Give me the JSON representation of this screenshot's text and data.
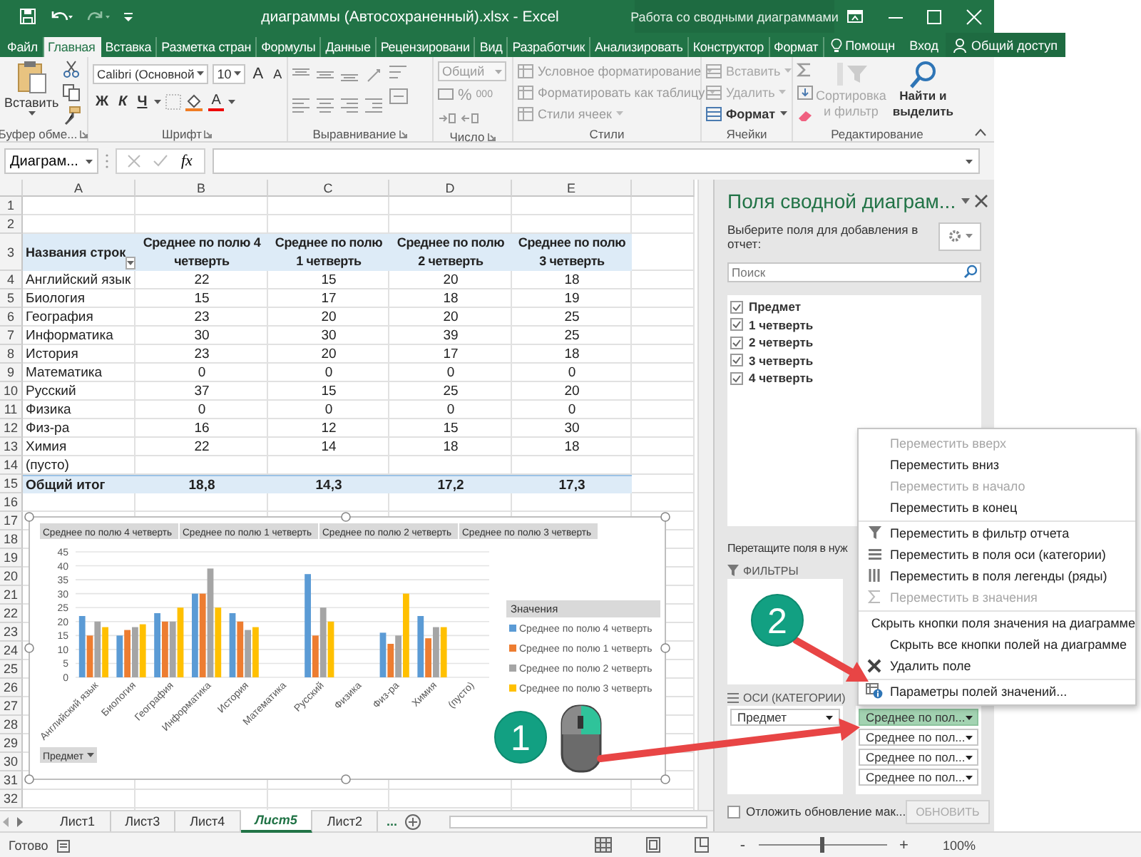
{
  "window": {
    "title": "диаграммы (Автосохраненный).xlsx - Excel",
    "context_title": "Работа со сводными диаграммами"
  },
  "ribbon_tabs": [
    {
      "label": "Файл",
      "selected": false
    },
    {
      "label": "Главная",
      "selected": true
    },
    {
      "label": "Вставка",
      "selected": false
    },
    {
      "label": "Разметка стран",
      "selected": false
    },
    {
      "label": "Формулы",
      "selected": false
    },
    {
      "label": "Данные",
      "selected": false
    },
    {
      "label": "Рецензировани",
      "selected": false
    },
    {
      "label": "Вид",
      "selected": false
    },
    {
      "label": "Разработчик",
      "selected": false
    },
    {
      "label": "Анализировать",
      "selected": false
    },
    {
      "label": "Конструктор",
      "selected": false
    },
    {
      "label": "Формат",
      "selected": false
    }
  ],
  "tell_me": "Помощн",
  "sign_in": "Вход",
  "share": "Общий доступ",
  "ribbon": {
    "clipboard": {
      "paste": "Вставить",
      "label": "Буфер обме..."
    },
    "font": {
      "name": "Calibri (Основной",
      "size": "10",
      "grow": "A",
      "shrink": "A",
      "bold": "Ж",
      "italic": "К",
      "underline": "Ч",
      "color_letter": "A",
      "label": "Шрифт"
    },
    "alignment": {
      "label": "Выравнивание"
    },
    "number": {
      "format": "Общий",
      "percent": "%",
      "thousands": "000",
      "label": "Число"
    },
    "styles": {
      "items": [
        "Условное форматирование",
        "Форматировать как таблицу",
        "Стили ячеек"
      ],
      "label": "Стили"
    },
    "cells": {
      "items": [
        {
          "label": "Вставить",
          "disabled": true
        },
        {
          "label": "Удалить",
          "disabled": true
        },
        {
          "label": "Формат",
          "disabled": false
        }
      ],
      "label": "Ячейки"
    },
    "editing": {
      "sort": {
        "label": "Сортировка и фильтр",
        "disabled": true
      },
      "find": "Найти и выделить",
      "label": "Редактирование"
    }
  },
  "formula_bar": {
    "name_box": "Диаграм...",
    "function_label": "fx"
  },
  "columns": [
    "A",
    "B",
    "C",
    "D",
    "E"
  ],
  "row_numbers": [
    "1",
    "2",
    "3",
    "4",
    "5",
    "6",
    "7",
    "8",
    "9",
    "10",
    "11",
    "12",
    "13",
    "14",
    "15",
    "16",
    "17",
    "18",
    "19",
    "20",
    "21",
    "22",
    "23",
    "24",
    "25",
    "26",
    "27",
    "28",
    "29",
    "30",
    "31",
    "32"
  ],
  "pivot_table": {
    "row_header": "Названия строк",
    "value_headers": [
      "Среднее по полю 4 четверть",
      "Среднее по полю 1 четверть",
      "Среднее по полю 2 четверть",
      "Среднее по полю 3 четверть"
    ],
    "rows": [
      {
        "label": "Английский язык",
        "values": [
          "22",
          "15",
          "20",
          "18"
        ]
      },
      {
        "label": "Биология",
        "values": [
          "15",
          "17",
          "18",
          "19"
        ]
      },
      {
        "label": "География",
        "values": [
          "23",
          "20",
          "20",
          "25"
        ]
      },
      {
        "label": "Информатика",
        "values": [
          "30",
          "30",
          "39",
          "25"
        ]
      },
      {
        "label": "История",
        "values": [
          "23",
          "20",
          "17",
          "18"
        ]
      },
      {
        "label": "Математика",
        "values": [
          "0",
          "0",
          "0",
          "0"
        ]
      },
      {
        "label": "Русский",
        "values": [
          "37",
          "15",
          "25",
          "20"
        ]
      },
      {
        "label": "Физика",
        "values": [
          "0",
          "0",
          "0",
          "0"
        ]
      },
      {
        "label": "Физ-ра",
        "values": [
          "16",
          "12",
          "15",
          "30"
        ]
      },
      {
        "label": "Химия",
        "values": [
          "22",
          "14",
          "18",
          "18"
        ]
      },
      {
        "label": "(пусто)",
        "values": []
      }
    ],
    "total": {
      "label": "Общий итог",
      "values": [
        "18,8",
        "14,3",
        "17,2",
        "17,3"
      ]
    }
  },
  "chart": {
    "field_buttons": [
      "Среднее по полю 4 четверть",
      "Среднее по полю 1 четверть",
      "Среднее по полю 2 четверть",
      "Среднее по полю 3 четверть"
    ],
    "axis_field_button": "Предмет",
    "legend_title": "Значения",
    "chart_data": {
      "type": "bar",
      "categories": [
        "Английский язык",
        "Биология",
        "География",
        "Информатика",
        "История",
        "Математика",
        "Русский",
        "Физика",
        "Физ-ра",
        "Химия",
        "(пусто)"
      ],
      "series": [
        {
          "name": "Среднее по полю 4 четверть",
          "color": "#5b9bd5",
          "values": [
            22,
            15,
            23,
            30,
            23,
            0,
            37,
            0,
            16,
            22,
            null
          ]
        },
        {
          "name": "Среднее по полю 1 четверть",
          "color": "#ed7d31",
          "values": [
            15,
            17,
            20,
            30,
            20,
            0,
            15,
            0,
            12,
            14,
            null
          ]
        },
        {
          "name": "Среднее по полю 2 четверть",
          "color": "#a5a5a5",
          "values": [
            20,
            18,
            20,
            39,
            17,
            0,
            25,
            0,
            15,
            18,
            null
          ]
        },
        {
          "name": "Среднее по полю 3 четверть",
          "color": "#ffc000",
          "values": [
            18,
            19,
            25,
            25,
            18,
            0,
            20,
            0,
            30,
            18,
            null
          ]
        }
      ],
      "ylim": [
        0,
        45
      ],
      "yticks": [
        0,
        5,
        10,
        15,
        20,
        25,
        30,
        35,
        40,
        45
      ],
      "grid": true,
      "legend": "right"
    }
  },
  "sheet_tabs": [
    {
      "label": "Лист1",
      "selected": false
    },
    {
      "label": "Лист3",
      "selected": false
    },
    {
      "label": "Лист4",
      "selected": false
    },
    {
      "label": "Лист5",
      "selected": true
    },
    {
      "label": "Лист2",
      "selected": false
    }
  ],
  "more_sheets": "...",
  "pane": {
    "title": "Поля сводной диаграм...",
    "prompt": "Выберите поля для добавления в отчет:",
    "search_placeholder": "Поиск",
    "fields": [
      {
        "label": "Предмет",
        "checked": true
      },
      {
        "label": "1 четверть",
        "checked": true
      },
      {
        "label": "2 четверть",
        "checked": true
      },
      {
        "label": "3 четверть",
        "checked": true
      },
      {
        "label": "4 четверть",
        "checked": true
      }
    ],
    "areas_prompt": "Перетащите поля в нуж",
    "filters_label": "ФИЛЬТРЫ",
    "axis_label": "ОСИ (КАТЕГОРИИ)",
    "axis_items": [
      "Предмет"
    ],
    "values": [
      {
        "label": "Среднее по пол...",
        "selected": true
      },
      {
        "label": "Среднее по пол...",
        "selected": false
      },
      {
        "label": "Среднее по пол...",
        "selected": false
      },
      {
        "label": "Среднее по пол...",
        "selected": false
      }
    ],
    "defer": {
      "label": "Отложить обновление мак...",
      "checked": false
    },
    "update": {
      "label": "ОБНОВИТЬ",
      "disabled": true
    }
  },
  "context_menu": {
    "items": [
      {
        "label": "Переместить вверх",
        "kind": "plain",
        "disabled": true,
        "separator_before": false
      },
      {
        "label": "Переместить вниз",
        "kind": "plain",
        "disabled": false,
        "separator_before": false
      },
      {
        "label": "Переместить в начало",
        "kind": "plain",
        "disabled": true,
        "separator_before": false
      },
      {
        "label": "Переместить в конец",
        "kind": "plain",
        "disabled": false,
        "separator_before": false
      },
      {
        "label": "Переместить в фильтр отчета",
        "kind": "filter",
        "disabled": false,
        "separator_before": true
      },
      {
        "label": "Переместить в поля оси (категории)",
        "kind": "axis",
        "disabled": false,
        "separator_before": false
      },
      {
        "label": "Переместить в поля легенды (ряды)",
        "kind": "legend",
        "disabled": false,
        "separator_before": false
      },
      {
        "label": "Переместить в значения",
        "kind": "sum",
        "disabled": true,
        "separator_before": false
      },
      {
        "label": "Скрыть кнопки поля значения на диаграмме",
        "kind": "plain",
        "disabled": false,
        "separator_before": true
      },
      {
        "label": "Скрыть все кнопки полей на диаграмме",
        "kind": "plain",
        "disabled": false,
        "separator_before": false
      },
      {
        "label": "Удалить поле",
        "kind": "delete",
        "disabled": false,
        "separator_before": false
      },
      {
        "label": "Параметры полей значений...",
        "kind": "settings",
        "disabled": false,
        "separator_before": true
      }
    ]
  },
  "status_bar": {
    "text": "Готово",
    "zoom_out": "-",
    "zoom_in": "+",
    "zoom": {
      "level": 0.5
    },
    "zoom_text": "100%"
  },
  "step_badges": [
    "1",
    "2"
  ]
}
